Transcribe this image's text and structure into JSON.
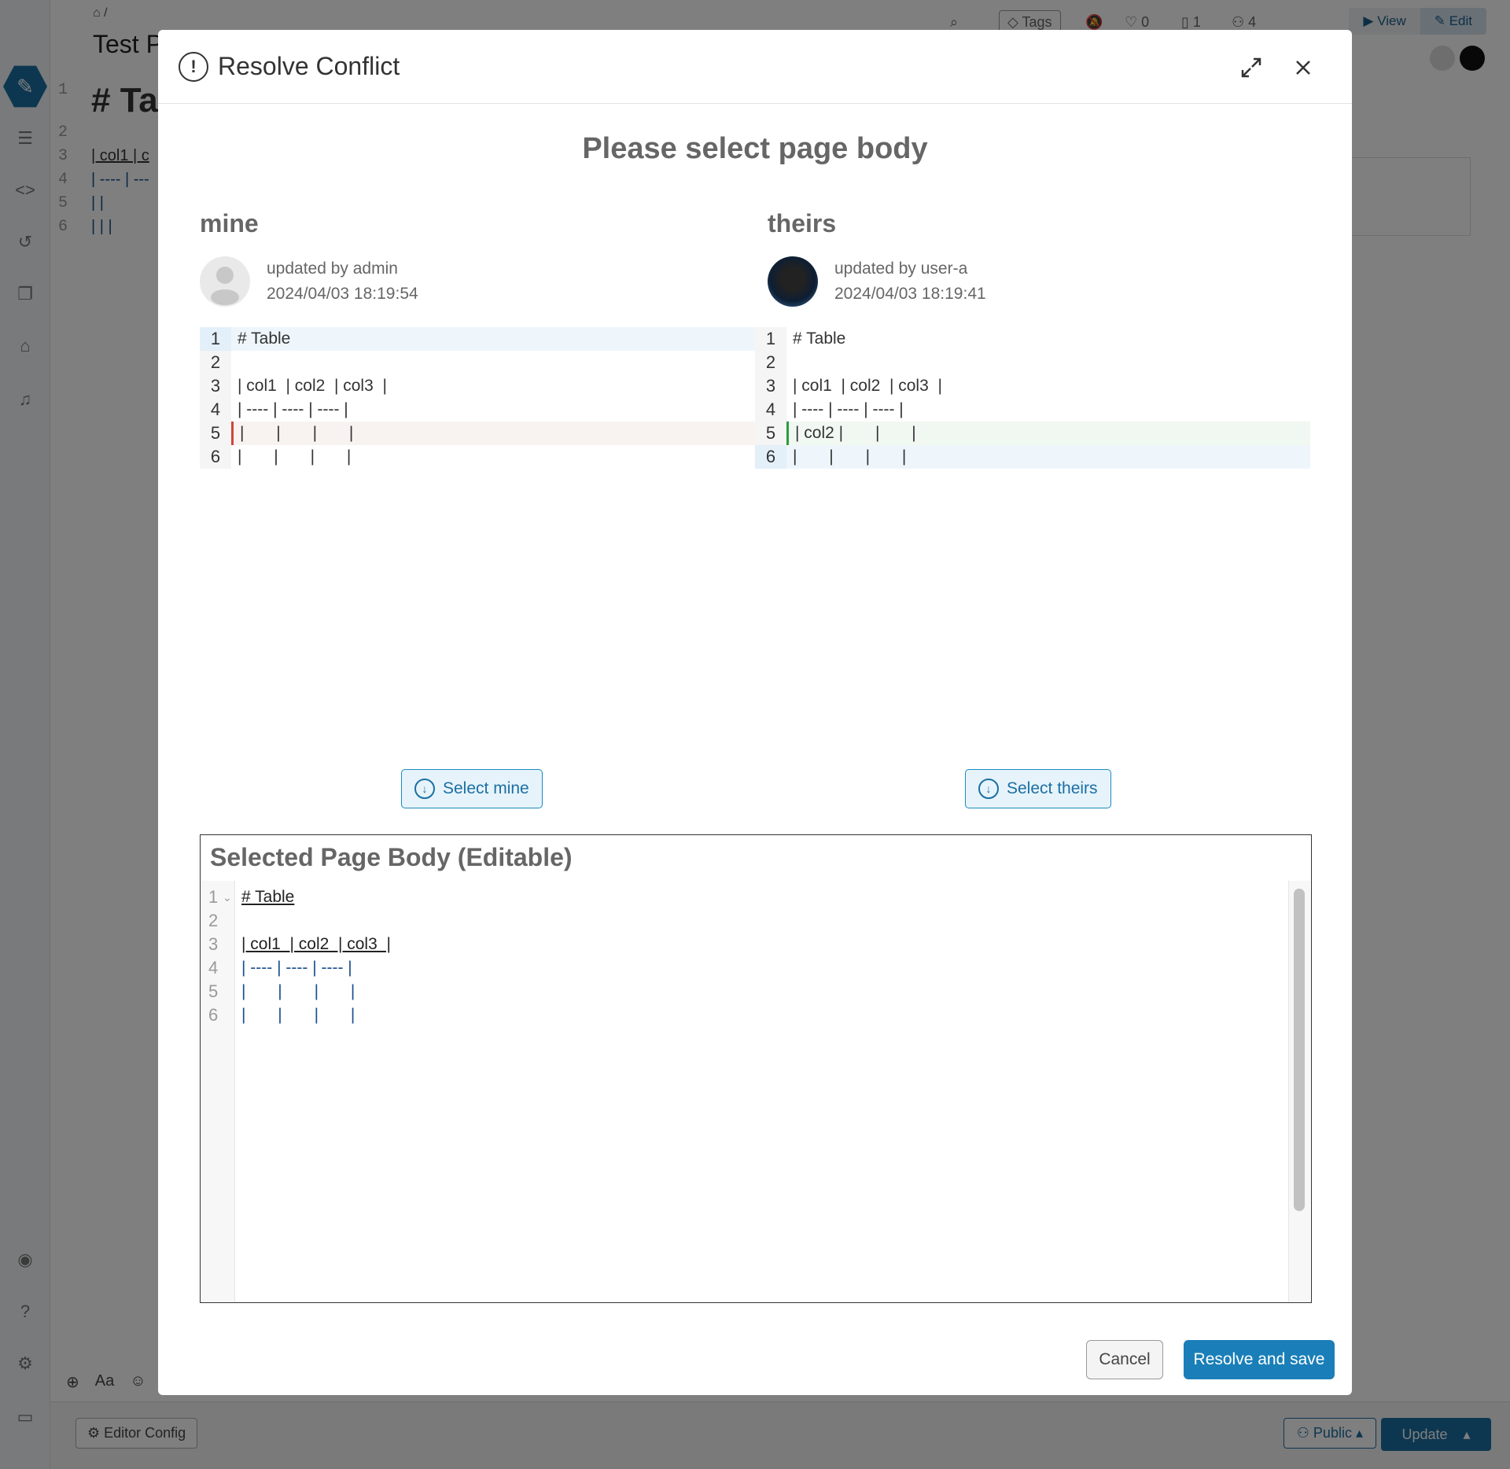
{
  "background": {
    "breadcrumb": "⌂ /",
    "page_title": "Test P",
    "toolbar": {
      "tags_label": "Tags",
      "likes_count": "0",
      "bookmarks_count": "1",
      "views_count": "4",
      "view_label": "View",
      "edit_label": "Edit"
    },
    "editor_lines": [
      {
        "num": "1",
        "text": "# Ta"
      },
      {
        "num": "2",
        "text": ""
      },
      {
        "num": "3",
        "text": "| col1 | c"
      },
      {
        "num": "4",
        "text": "| ---- | ---"
      },
      {
        "num": "5",
        "text": "|      |"
      },
      {
        "num": "6",
        "text": "|    |    |"
      }
    ],
    "editor_tools": {
      "format_label": "Aa"
    },
    "bottom_bar": {
      "editor_config_label": "Editor Config",
      "public_label": "Public",
      "update_label": "Update"
    }
  },
  "modal": {
    "title": "Resolve Conflict",
    "heading": "Please select page body",
    "mine": {
      "label": "mine",
      "updated_by": "updated by admin",
      "updated_at": "2024/04/03 18:19:54",
      "lines": [
        {
          "num": "1",
          "text": "# Table"
        },
        {
          "num": "2",
          "text": ""
        },
        {
          "num": "3",
          "text": "| col1  | col2  | col3  |"
        },
        {
          "num": "4",
          "text": "| ---- | ---- | ---- |"
        },
        {
          "num": "5",
          "text": "|       |       |       |"
        },
        {
          "num": "6",
          "text": "|       |       |       |"
        }
      ],
      "select_label": "Select mine"
    },
    "theirs": {
      "label": "theirs",
      "updated_by": "updated by user-a",
      "updated_at": "2024/04/03 18:19:41",
      "lines": [
        {
          "num": "1",
          "text": "# Table"
        },
        {
          "num": "2",
          "text": ""
        },
        {
          "num": "3",
          "text": "| col1  | col2  | col3  |"
        },
        {
          "num": "4",
          "text": "| ---- | ---- | ---- |"
        },
        {
          "num": "5",
          "text": "| col2 |       |       |"
        },
        {
          "num": "6",
          "text": "|       |       |       |"
        }
      ],
      "select_label": "Select theirs"
    },
    "selected": {
      "title": "Selected Page Body (Editable)",
      "lines": [
        {
          "num": "1",
          "text": "# Table"
        },
        {
          "num": "2",
          "text": ""
        },
        {
          "num": "3",
          "text": "| col1  | col2  | col3  |"
        },
        {
          "num": "4",
          "text": "| ---- | ---- | ---- |"
        },
        {
          "num": "5",
          "text": "|       |       |       |"
        },
        {
          "num": "6",
          "text": "|       |       |       |"
        }
      ]
    },
    "cancel_label": "Cancel",
    "resolve_label": "Resolve and save"
  }
}
